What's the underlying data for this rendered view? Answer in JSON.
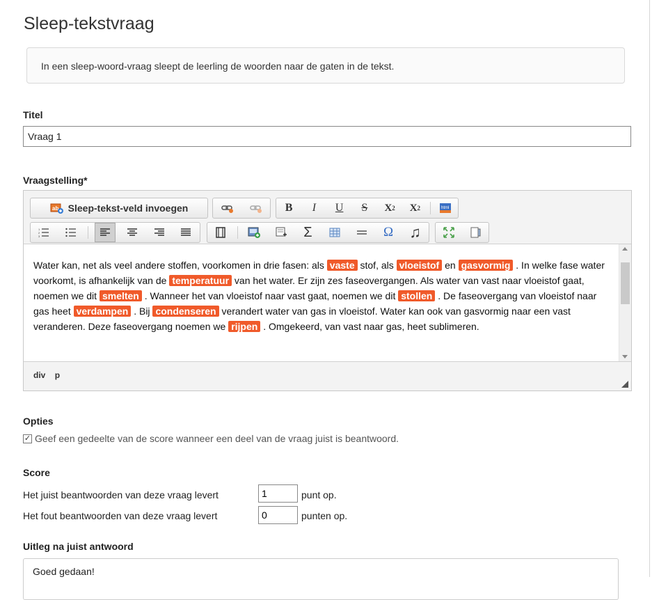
{
  "page": {
    "title": "Sleep-tekstvraag",
    "intro": "In een sleep-woord-vraag sleept de leerling de woorden naar de gaten in de tekst."
  },
  "titel": {
    "label": "Titel",
    "value": "Vraag 1"
  },
  "vraagstelling": {
    "label": "Vraagstelling*",
    "toolbar": {
      "insert_field_label": "Sleep-tekst-veld invoegen",
      "bold": "B",
      "italic": "I",
      "underline": "U",
      "strike": "S",
      "subscript": "X",
      "subscript_small": "2",
      "superscript": "X",
      "superscript_small": "2",
      "sigma": "Σ",
      "omega": "Ω",
      "music": "♫"
    },
    "content": [
      {
        "t": "Water kan, net als veel andere stoffen, voorkomen in drie fasen: als "
      },
      {
        "tag": "vaste"
      },
      {
        "t": " stof, als "
      },
      {
        "tag": "vloeistof"
      },
      {
        "t": " en "
      },
      {
        "tag": "gasvormig"
      },
      {
        "t": " . In welke fase water voorkomt, is afhankelijk van de "
      },
      {
        "tag": "temperatuur"
      },
      {
        "t": " van het water. Er zijn zes faseovergangen. Als water van vast naar vloeistof gaat, noemen we dit "
      },
      {
        "tag": "smelten"
      },
      {
        "t": " . Wanneer het van vloeistof naar vast gaat, noemen we dit "
      },
      {
        "tag": "stollen"
      },
      {
        "t": " . De faseovergang van vloeistof naar gas heet "
      },
      {
        "tag": "verdampen"
      },
      {
        "t": " . Bij "
      },
      {
        "tag": "condenseren"
      },
      {
        "t": " verandert water van gas in vloeistof. Water kan ook van gasvormig naar een vast veranderen. Deze faseovergang noemen we "
      },
      {
        "tag": "rijpen"
      },
      {
        "t": " . Omgekeerd, van vast naar gas, heet sublimeren."
      }
    ],
    "status_path": [
      "div",
      "p"
    ]
  },
  "opties": {
    "label": "Opties",
    "partial_score_checked": true,
    "checkmark": "✓",
    "partial_score_label": "Geef een gedeelte van de score wanneer een deel van de vraag juist is beantwoord."
  },
  "score": {
    "label": "Score",
    "correct_prefix": "Het juist beantwoorden van deze vraag levert",
    "correct_value": "1",
    "correct_suffix": "punt op.",
    "wrong_prefix": "Het fout beantwoorden van deze vraag levert",
    "wrong_value": "0",
    "wrong_suffix": "punten op."
  },
  "uitleg": {
    "label": "Uitleg na juist antwoord",
    "value": "Goed gedaan!"
  }
}
